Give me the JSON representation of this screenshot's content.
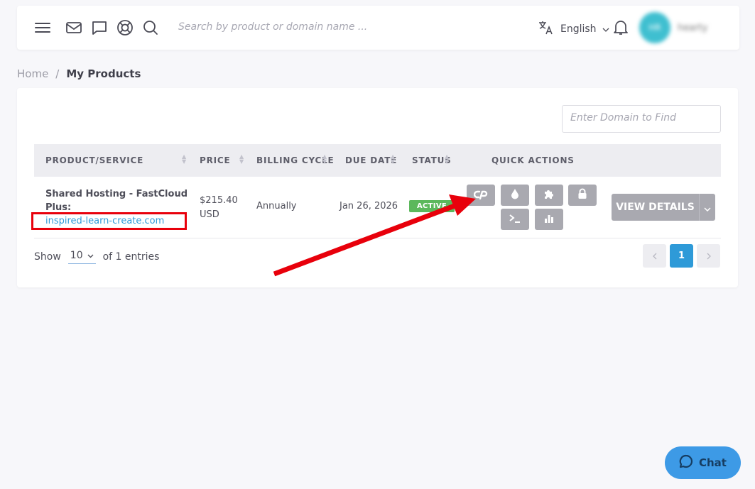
{
  "topbar": {
    "search_placeholder": "Search by product or domain name ...",
    "language": "English",
    "user_initials": "HR",
    "user_name": "hearty"
  },
  "breadcrumb": {
    "home": "Home",
    "separator": "/",
    "current": "My Products"
  },
  "filter": {
    "placeholder": "Enter Domain to Find"
  },
  "table": {
    "headers": [
      "PRODUCT/SERVICE",
      "PRICE",
      "BILLING CYCLE",
      "DUE DATE",
      "STATUS",
      "QUICK ACTIONS"
    ],
    "rows": [
      {
        "product": "Shared Hosting - FastCloud Plus:",
        "domain": "inspired-learn-create.com",
        "price_amount": "$215.40",
        "price_currency": "USD",
        "billing_cycle": "Annually",
        "due_date": "Jan 26, 2026",
        "status": "ACTIVE",
        "view_details": "VIEW DETAILS"
      }
    ]
  },
  "footer": {
    "show_label": "Show",
    "page_size": "10",
    "entries_text": "of 1 entries",
    "current_page": "1"
  },
  "quick_action_icons": [
    "cpanel-icon",
    "droplet-icon",
    "puzzle-icon",
    "lock-icon",
    "terminal-icon",
    "stats-icon"
  ],
  "chat": {
    "label": "Chat"
  },
  "colors": {
    "accent": "#2e9ad8",
    "status_active": "#5cb85c",
    "annotation": "#e8000b",
    "button_gray": "#a9a9b0"
  }
}
